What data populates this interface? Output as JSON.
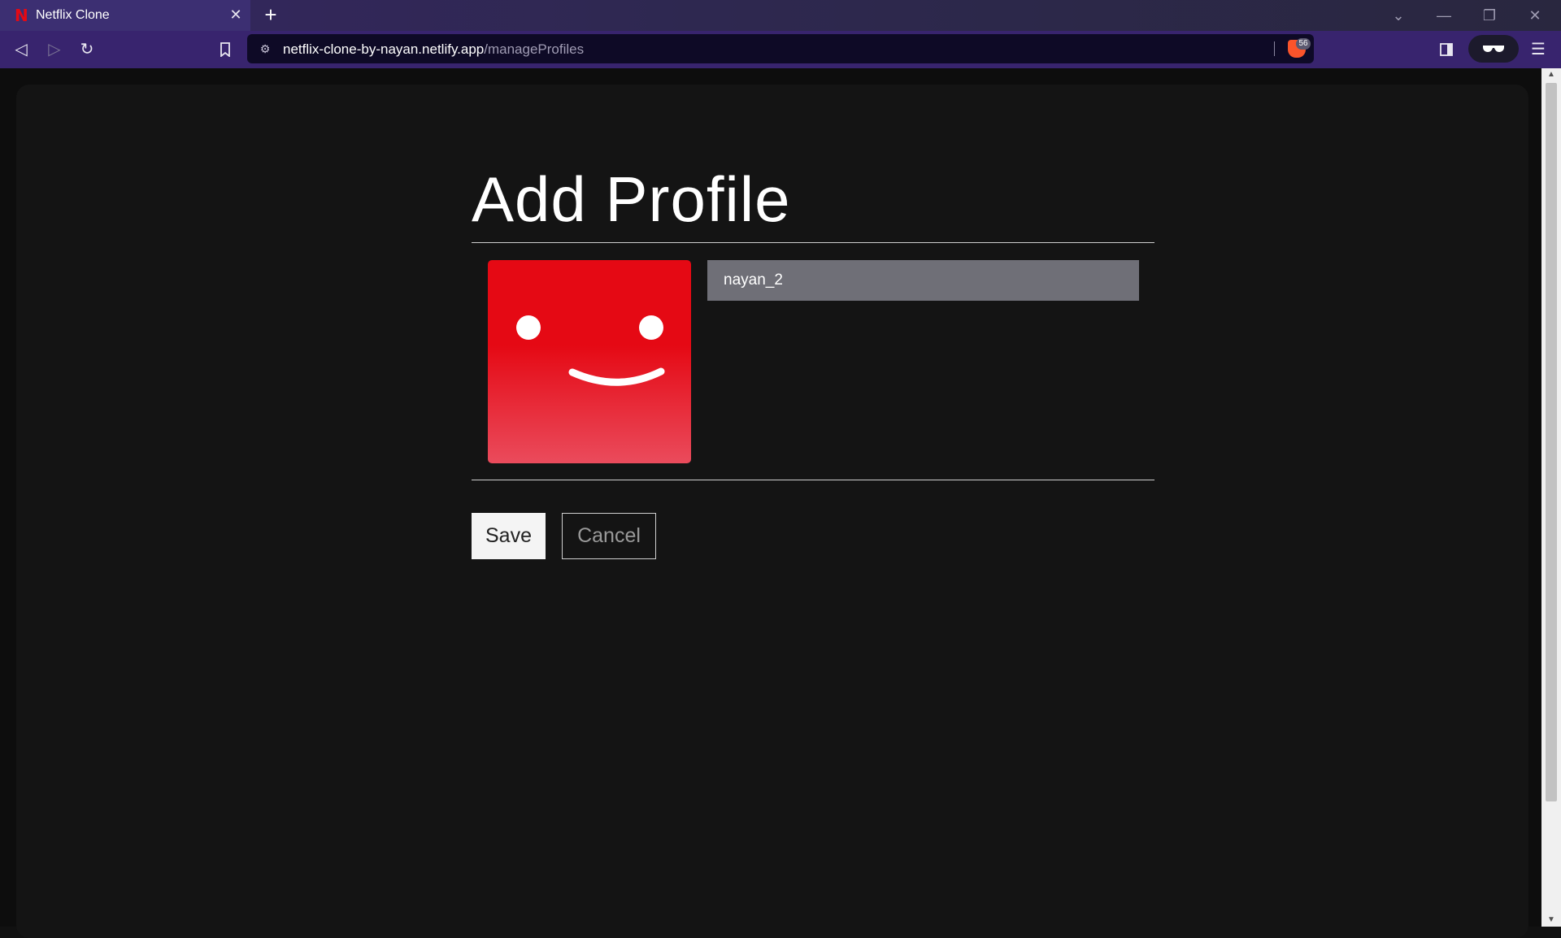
{
  "browser": {
    "tab": {
      "title": "Netflix Clone",
      "favicon": "netflix-n-icon",
      "close_glyph": "✕"
    },
    "new_tab_glyph": "+",
    "url": {
      "host": "netflix-clone-by-nayan.netlify.app",
      "path": "/manageProfiles"
    },
    "shield_count": "56",
    "window_controls": [
      "chevron-down-icon",
      "minimize-icon",
      "restore-icon",
      "close-icon"
    ]
  },
  "page": {
    "title": "Add Profile",
    "profile_name_value": "nayan_2",
    "save_label": "Save",
    "cancel_label": "Cancel"
  },
  "colors": {
    "netflix_red": "#e50914",
    "background": "#141414",
    "input_bg": "#6f6f77"
  }
}
